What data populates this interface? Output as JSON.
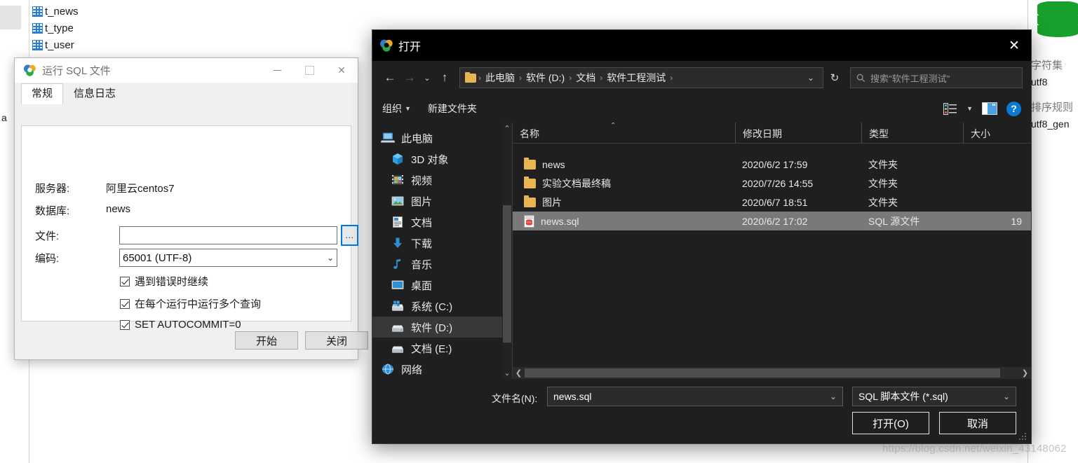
{
  "background": {
    "tree_items": [
      {
        "label": "t_news",
        "icon": "table-icon"
      },
      {
        "label": "t_type",
        "icon": "table-icon"
      },
      {
        "label": "t_user",
        "icon": "table-icon"
      }
    ],
    "left_fragment": "a",
    "right_panel": {
      "db_icon": "database-cylinder-icon",
      "charset_label": "字符集",
      "charset_value": "utf8",
      "collation_label": "排序规则",
      "collation_value": "utf8_gen"
    }
  },
  "sql_dialog": {
    "title": "运行 SQL 文件",
    "app_icon": "navicat-icon",
    "window_buttons": {
      "minimize": "minimize-icon",
      "maximize": "maximize-icon",
      "close": "close-icon"
    },
    "tabs": [
      {
        "label": "常规",
        "active": true
      },
      {
        "label": "信息日志",
        "active": false
      }
    ],
    "fields": {
      "server_label": "服务器:",
      "server_value": "阿里云centos7",
      "database_label": "数据库:",
      "database_value": "news",
      "file_label": "文件:",
      "file_value": "",
      "browse_label": "...",
      "encoding_label": "编码:",
      "encoding_value": "65001 (UTF-8)"
    },
    "checkboxes": [
      {
        "label": "遇到错误时继续",
        "checked": true
      },
      {
        "label": "在每个运行中运行多个查询",
        "checked": true
      },
      {
        "label": "SET AUTOCOMMIT=0",
        "checked": true
      }
    ],
    "buttons": {
      "start": "开始",
      "close": "关闭"
    }
  },
  "open_dialog": {
    "title": "打开",
    "app_icon": "navicat-icon",
    "close_glyph": "✕",
    "nav": {
      "back": "←",
      "forward": "→",
      "recent": "⌄",
      "up": "↑",
      "breadcrumbs": [
        "此电脑",
        "软件 (D:)",
        "文档",
        "软件工程测试"
      ],
      "dropdown": "⌄",
      "refresh": "↻",
      "search_placeholder": "搜索\"软件工程测试\""
    },
    "command_bar": {
      "organize": "组织",
      "new_folder": "新建文件夹",
      "view_icon": "details-view-icon",
      "view_caret": "▼",
      "preview_icon": "preview-pane-icon",
      "help_label": "?"
    },
    "nav_pane": {
      "items": [
        {
          "label": "此电脑",
          "icon": "this-pc-icon",
          "level": 0,
          "selected": false
        },
        {
          "label": "3D 对象",
          "icon": "3d-objects-icon",
          "level": 1,
          "selected": false
        },
        {
          "label": "视频",
          "icon": "videos-icon",
          "level": 1,
          "selected": false
        },
        {
          "label": "图片",
          "icon": "pictures-icon",
          "level": 1,
          "selected": false
        },
        {
          "label": "文档",
          "icon": "documents-icon",
          "level": 1,
          "selected": false
        },
        {
          "label": "下载",
          "icon": "downloads-icon",
          "level": 1,
          "selected": false
        },
        {
          "label": "音乐",
          "icon": "music-icon",
          "level": 1,
          "selected": false
        },
        {
          "label": "桌面",
          "icon": "desktop-icon",
          "level": 1,
          "selected": false
        },
        {
          "label": "系统 (C:)",
          "icon": "system-drive-icon",
          "level": 1,
          "selected": false
        },
        {
          "label": "软件 (D:)",
          "icon": "drive-icon",
          "level": 1,
          "selected": true
        },
        {
          "label": "文档 (E:)",
          "icon": "drive-icon",
          "level": 1,
          "selected": false
        },
        {
          "label": "网络",
          "icon": "network-icon",
          "level": 0,
          "selected": false
        }
      ],
      "scroll_up": "⌃",
      "scroll_down": "⌄"
    },
    "file_list": {
      "columns": [
        "名称",
        "修改日期",
        "类型",
        "大小"
      ],
      "sort_column": "名称",
      "sort_caret": "⌃",
      "rows": [
        {
          "name": "news",
          "modified": "2020/6/2 17:59",
          "type": "文件夹",
          "size": "",
          "icon": "folder-icon",
          "selected": false
        },
        {
          "name": "实验文档最终稿",
          "modified": "2020/7/26 14:55",
          "type": "文件夹",
          "size": "",
          "icon": "folder-icon",
          "selected": false
        },
        {
          "name": "图片",
          "modified": "2020/6/7 18:51",
          "type": "文件夹",
          "size": "",
          "icon": "folder-icon",
          "selected": false
        },
        {
          "name": "news.sql",
          "modified": "2020/6/2 17:02",
          "type": "SQL 源文件",
          "size": "19",
          "icon": "sql-file-icon",
          "selected": true
        }
      ],
      "hscroll_left": "❮",
      "hscroll_right": "❯"
    },
    "bottom": {
      "filename_label": "文件名(N):",
      "filename_value": "news.sql",
      "filename_chevron": "⌄",
      "filter_value": "SQL 脚本文件 (*.sql)",
      "filter_chevron": "⌄",
      "open_button": "打开(O)",
      "cancel_button": "取消"
    }
  },
  "watermark": "https://blog.csdn.net/weixin_43148062",
  "colors": {
    "accent_blue": "#0a7ad4",
    "dialog_dark": "#1f1f1f",
    "titlebar_black": "#000000",
    "selection_gray": "#797979",
    "folder_yellow": "#e8b552"
  }
}
